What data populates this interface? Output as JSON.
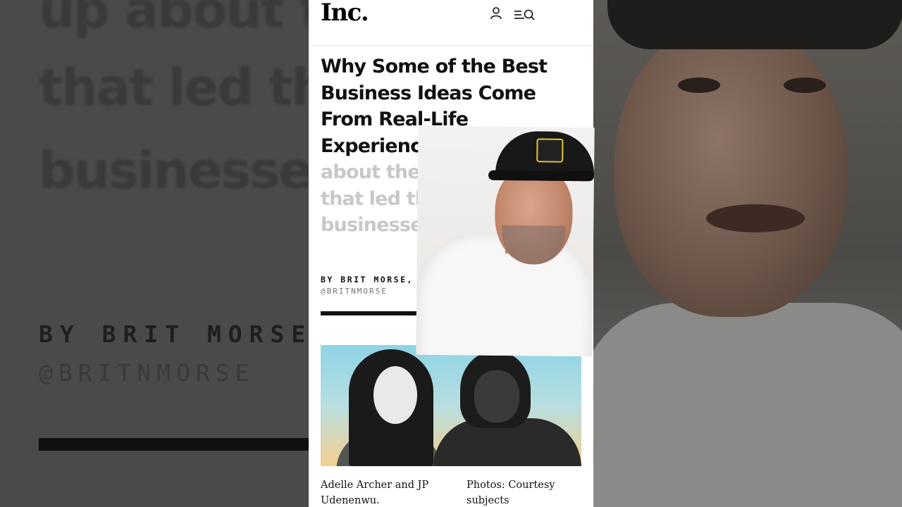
{
  "background_left": {
    "line1": "up about the",
    "line2": "that led ther",
    "line3": "businesses.",
    "byline": "BY BRIT MORSE,",
    "handle": "@BRITNMORSE"
  },
  "site": {
    "logo": "Inc.",
    "icons": [
      "user-icon",
      "menu-search-icon"
    ]
  },
  "article": {
    "headline": "Why Some of the Best Business Ideas Come From Real-Life Experiences",
    "subhead": "Founde up about the personal ex that led them to start th businesses.",
    "byline": "BY BRIT MORSE, A",
    "handle": "@BRITNMORSE",
    "caption": "Adelle Archer and JP Udenenwu.",
    "credit": "Photos: Courtesy subjects"
  },
  "colors": {
    "headline": "#111111",
    "subhead": "#c8c8c8",
    "hero_top": "#8fd3e6",
    "hero_bottom": "#f3cf8f"
  }
}
